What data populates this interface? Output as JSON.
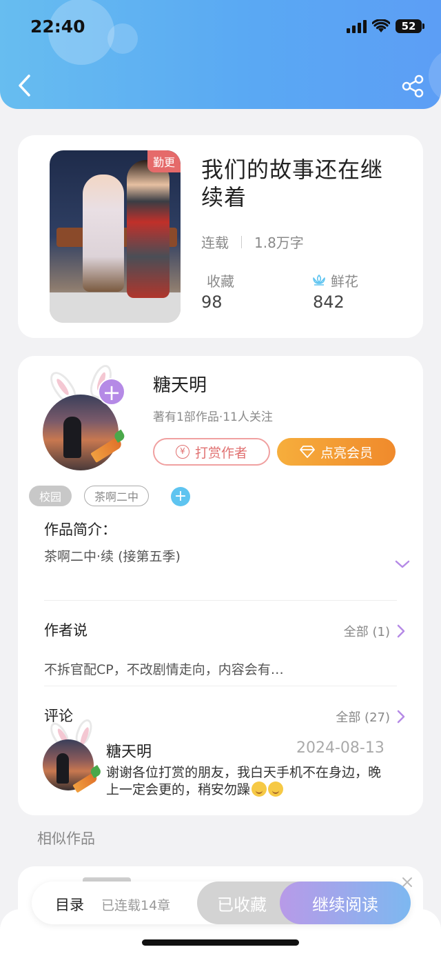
{
  "status_bar": {
    "time": "22:40",
    "battery": "52"
  },
  "book": {
    "badge": "勤更",
    "title": "我们的故事还在继续着",
    "status": "连载",
    "word_count": "1.8万字",
    "favorites_label": "收藏",
    "favorites_value": "98",
    "flowers_label": "鲜花",
    "flowers_value": "842"
  },
  "author": {
    "name": "糖天明",
    "subtitle": "著有1部作品·11人关注",
    "reward_button": "打赏作者",
    "vip_button": "点亮会员",
    "follow_plus": "+"
  },
  "tags": [
    "校园",
    "茶啊二中"
  ],
  "tag_add": "+",
  "intro": {
    "title": "作品简介：",
    "text": "茶啊二中·续 (接第五季)"
  },
  "author_says": {
    "title": "作者说",
    "more": "全部 (1)",
    "text": "不拆官配CP，不改剧情走向，内容会有…"
  },
  "comments": {
    "title": "评论",
    "more": "全部 (27)",
    "items": [
      {
        "name": "糖天明",
        "date": "2024-08-13",
        "text": "谢谢各位打赏的朋友，我白天手机不在身边，晚上一定会更的，稍安勿躁"
      }
    ]
  },
  "similar": {
    "title": "相似作品"
  },
  "bottom_bar": {
    "catalog": "目录",
    "chapters": "已连载14章",
    "collected": "已收藏",
    "continue": "继续阅读"
  },
  "colors": {
    "header": "#5aa9f3",
    "accent_purple": "#b58ae6",
    "vip_orange": "#f08a2c",
    "reward_red": "#e07070"
  },
  "icons": [
    "back-icon",
    "share-icon",
    "flower-icon",
    "yen-icon",
    "diamond-icon",
    "chevron-down-icon",
    "chevron-right-icon",
    "close-icon"
  ]
}
